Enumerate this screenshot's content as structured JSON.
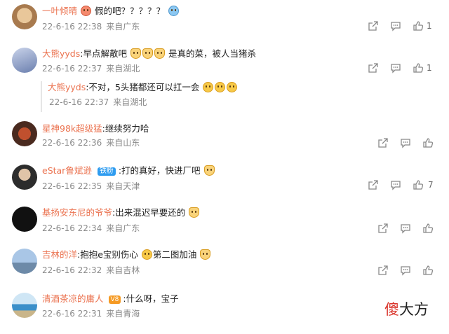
{
  "comments": [
    {
      "user": "一叶倾晴",
      "text": "假的吧？？？？？",
      "time": "22-6-16 22:38",
      "loc": "来自广东",
      "likes": "1"
    },
    {
      "user": "大熊yyds",
      "text_a": ":早点解散吧",
      "text_b": "是真的菜，被人当猪杀",
      "time": "22-6-16 22:37",
      "loc": "来自湖北",
      "likes": "1"
    },
    {
      "user": "大熊yyds",
      "text": ":不对，5头猪都还可以扛一会",
      "time": "22-6-16 22:37",
      "loc": "来自湖北"
    },
    {
      "user": "星神98k超级猛",
      "text": ":继续努力哈",
      "time": "22-6-16 22:36",
      "loc": "来自山东",
      "likes": ""
    },
    {
      "user": "eStar鲁斌逊",
      "badge": "铁粉",
      "text": ":打的真好，快进厂吧",
      "time": "22-6-16 22:35",
      "loc": "来自天津",
      "likes": "7"
    },
    {
      "user": "基扬安东尼的爷爷",
      "text": ":出来混迟早要还的",
      "time": "22-6-16 22:34",
      "loc": "来自广东",
      "likes": ""
    },
    {
      "user": "吉林的洋",
      "text_a": ":抱抱e宝别伤心",
      "text_b": "第二图加油",
      "time": "22-6-16 22:32",
      "loc": "来自吉林",
      "likes": ""
    },
    {
      "user": "清酒茶凉的庸人",
      "vip": "V8",
      "text": ":什么呀，宝子",
      "time": "22-6-16 22:31",
      "loc": "来自青海",
      "likes": ""
    }
  ],
  "watermark": {
    "first": "傻",
    "rest": "大方"
  },
  "icons": [
    "share-icon",
    "comment-icon",
    "like-icon"
  ]
}
